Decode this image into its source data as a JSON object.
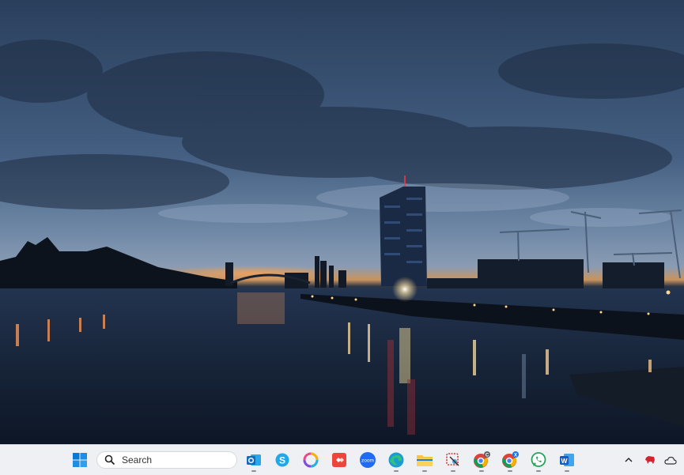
{
  "desktop": {
    "wallpaper": "Frankfurt river skyline at dusk"
  },
  "taskbar": {
    "search": {
      "label": "Search"
    },
    "apps": [
      {
        "name": "Outlook",
        "color": "#0f6cbd"
      },
      {
        "name": "Skype",
        "color": "#1fa8ea"
      },
      {
        "name": "Photos",
        "color": "#e8498b"
      },
      {
        "name": "AnyDesk",
        "color": "#ef443b"
      },
      {
        "name": "Zoom",
        "color": "#1f6bf2",
        "text": "zoom"
      },
      {
        "name": "Edge",
        "color": "#1c9ad6"
      },
      {
        "name": "File Explorer",
        "color": "#f4c542"
      },
      {
        "name": "Snipping Tool",
        "color": "#d13b3b"
      },
      {
        "name": "Chrome",
        "color": "#db4437",
        "badge": "C"
      },
      {
        "name": "Chrome",
        "color": "#4285f4",
        "badge": "X"
      },
      {
        "name": "WhatsApp",
        "color": "#25d366"
      },
      {
        "name": "Word",
        "color": "#185abd",
        "text": "W"
      }
    ],
    "tray": {
      "chevron": "^"
    }
  },
  "colors": {
    "taskbar_bg": "#eef0f3",
    "accent": "#0078d4"
  }
}
